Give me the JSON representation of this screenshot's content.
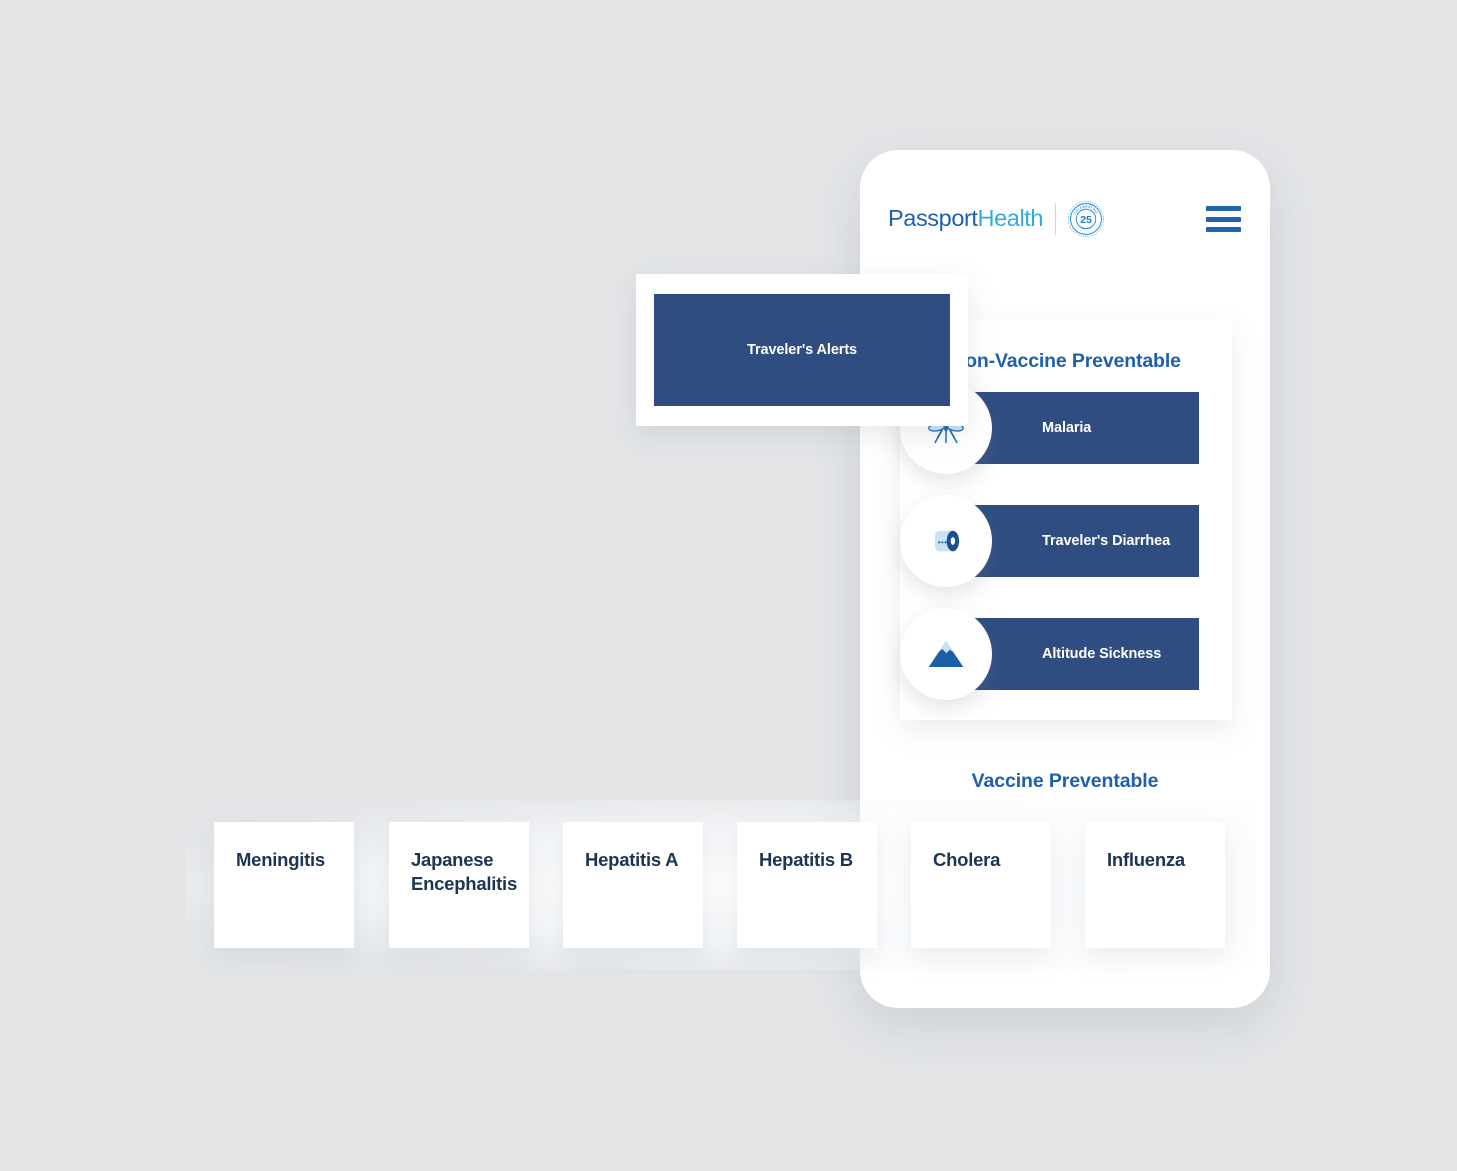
{
  "background_color": "#e3e5e7",
  "brand": {
    "logo_word_1": "Passport",
    "logo_word_2": "Health",
    "logo_color_1": "#1f5fae",
    "logo_color_2": "#33a9e0",
    "badge": {
      "number": "25",
      "top_text": "CELEBRATING",
      "bottom_text": "YEARS"
    },
    "menu_icon": "hamburger-menu-icon",
    "accent_blue": "#1f5fae",
    "panel_blue": "#2f4d80",
    "card_text_color": "#1c3553"
  },
  "alerts_card": {
    "label": "Traveler's Alerts"
  },
  "non_vaccine_panel": {
    "title": "Non-Vaccine Preventable",
    "rows": [
      {
        "label": "Malaria",
        "icon": "mosquito-icon"
      },
      {
        "label": "Traveler's Diarrhea",
        "icon": "toilet-paper-icon"
      },
      {
        "label": "Altitude Sickness",
        "icon": "mountain-icon"
      }
    ]
  },
  "vaccine_section": {
    "title": "Vaccine Preventable",
    "cards": [
      {
        "label": "Meningitis"
      },
      {
        "label": "Japanese Encephalitis"
      },
      {
        "label": "Hepatitis A"
      },
      {
        "label": "Hepatitis B"
      },
      {
        "label": "Cholera"
      },
      {
        "label": "Influenza"
      }
    ]
  }
}
